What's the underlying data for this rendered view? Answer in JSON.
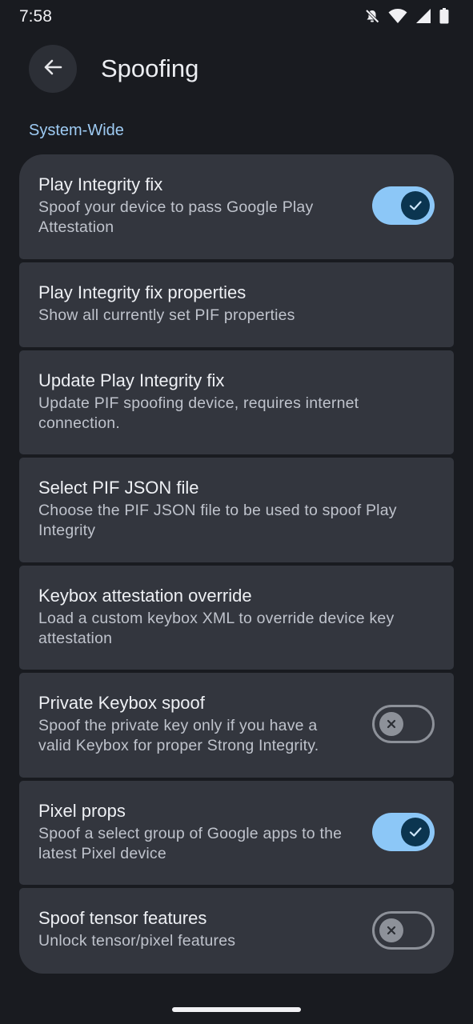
{
  "status_bar": {
    "time": "7:58"
  },
  "app_bar": {
    "title": "Spoofing"
  },
  "section": {
    "title": "System-Wide"
  },
  "items": [
    {
      "title": "Play Integrity fix",
      "summary": "Spoof your device to pass Google Play Attestation",
      "toggle": "on"
    },
    {
      "title": "Play Integrity fix properties",
      "summary": "Show all currently set PIF properties"
    },
    {
      "title": "Update Play Integrity fix",
      "summary": "Update PIF spoofing device, requires internet connection."
    },
    {
      "title": "Select PIF JSON file",
      "summary": "Choose the PIF JSON file to be used to spoof Play Integrity"
    },
    {
      "title": "Keybox attestation override",
      "summary": "Load a custom keybox XML to override device key attestation"
    },
    {
      "title": "Private Keybox spoof",
      "summary": "Spoof the private key only if you have a valid Keybox for proper Strong Integrity.",
      "toggle": "off"
    },
    {
      "title": "Pixel props",
      "summary": "Spoof a select group of Google apps to the latest Pixel device",
      "toggle": "on"
    },
    {
      "title": "Spoof tensor features",
      "summary": "Unlock tensor/pixel features",
      "toggle": "off"
    }
  ],
  "colors": {
    "background": "#191b20",
    "card": "#33363e",
    "accent": "#8cc7f7",
    "section_header": "#9ecbf3"
  }
}
